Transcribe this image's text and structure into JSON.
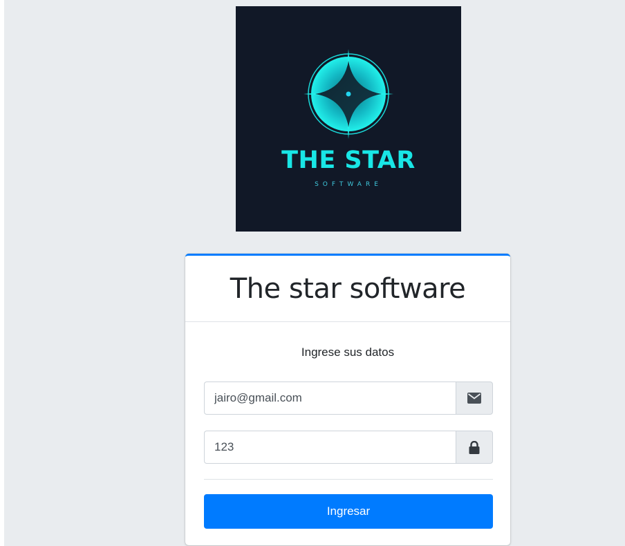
{
  "logo": {
    "brand": "THE STAR",
    "tagline": "SOFTWARE",
    "colors": {
      "background": "#111827",
      "accent": "#19e6e6"
    }
  },
  "login": {
    "title": "The star software",
    "subtitle": "Ingrese sus datos",
    "email": {
      "value": "jairo@gmail.com",
      "icon": "envelope-icon"
    },
    "password": {
      "value": "123",
      "icon": "lock-icon"
    },
    "submit_label": "Ingresar",
    "colors": {
      "primary": "#007bff",
      "background": "#e9ecef"
    }
  }
}
